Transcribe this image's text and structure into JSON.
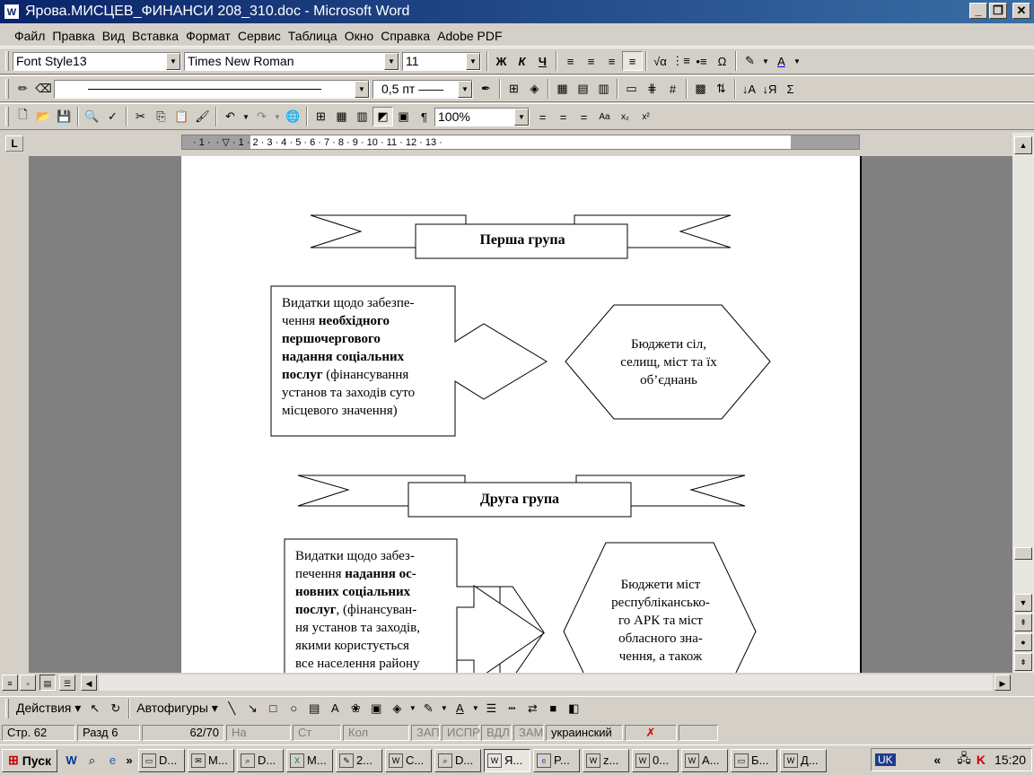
{
  "window": {
    "title": "Ярова.МИСЦЕВ_ФИНАНСИ 208_310.doc - Microsoft Word",
    "app_icon": "W",
    "minimize": "_",
    "restore": "❐",
    "close": "✕"
  },
  "menu": [
    "Файл",
    "Правка",
    "Вид",
    "Вставка",
    "Формат",
    "Сервис",
    "Таблица",
    "Окно",
    "Справка",
    "Adobe PDF"
  ],
  "format_toolbar": {
    "style": "Font Style13",
    "font": "Times New Roman",
    "size": "11",
    "bold": "Ж",
    "italic": "К",
    "underline": "Ч"
  },
  "tables_toolbar": {
    "line_weight": "0,5 пт ——"
  },
  "standard_toolbar": {
    "zoom": "100%"
  },
  "ruler": {
    "tab_selector": "L",
    "marks": "· 1 · ‌ · ▽ · 1 · 2 · 3 · 4 · 5 · 6 · 7 · 8 · 9 · 10 · 11 · 12 · 13 ·"
  },
  "document": {
    "group1_title": "Перша група",
    "group1_box": {
      "line1": "Видатки щодо забезпе-",
      "line2_plain": "чення ",
      "line2_bold": "необхідного",
      "line3_bold": "першочергового",
      "line4_bold": "надання соціальних",
      "line5_bold": "послуг",
      "line5_plain": " (фінансування",
      "line6": "установ та заходів суто",
      "line7": "місцевого значення)"
    },
    "group1_hex": [
      "Бюджети сіл,",
      "селищ, міст та їх",
      "об’єднань"
    ],
    "group2_title": "Друга група",
    "group2_box": {
      "line1": "Видатки   щодо забез-",
      "line2_plain": "печення ",
      "line2_bold": "надання ос-",
      "line3_bold": "новних соціальних",
      "line4_bold": "послуг",
      "line4_plain": ", (фінансуван-",
      "line5": "ня установ та заходів,",
      "line6": "якими користується",
      "line7": "все населення району"
    },
    "group2_hex": [
      "Бюджети міст",
      "республікансько-",
      "го АРК та міст",
      "обласного зна-",
      "чення, а також"
    ]
  },
  "drawing_toolbar": {
    "actions": "Действия ▾",
    "autoshapes": "Автофигуры ▾"
  },
  "status": {
    "page": "Стр. 62",
    "section": "Разд 6",
    "pages": "62/70",
    "at": "На",
    "line": "Ст",
    "col": "Кол",
    "rec": "ЗАП",
    "trk": "ИСПР",
    "ext": "ВДЛ",
    "ovr": "ЗАМ",
    "language": "украинский"
  },
  "taskbar": {
    "start": "Пуск",
    "quicklaunch_more": "»",
    "tasks": [
      "D...",
      "M...",
      "D...",
      "M...",
      "2...",
      "C...",
      "D...",
      "Я...",
      "P...",
      "z...",
      "0...",
      "A...",
      "Б...",
      "Д..."
    ],
    "lang": "UK",
    "tray_more": "«",
    "clock": "15:20"
  }
}
